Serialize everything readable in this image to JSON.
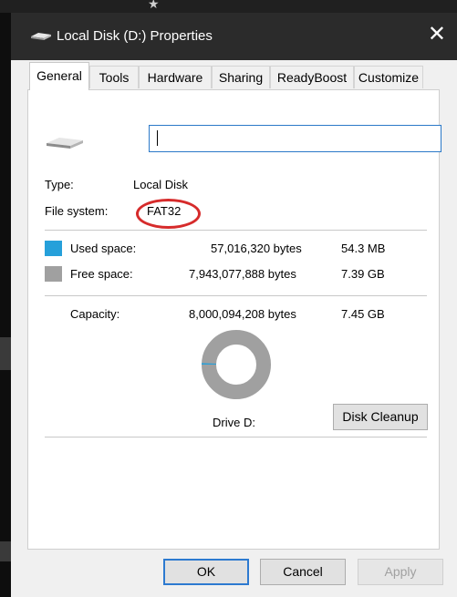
{
  "window": {
    "title": "Local Disk (D:) Properties",
    "close_glyph": "✕"
  },
  "tabs": [
    {
      "label": "General",
      "active": true
    },
    {
      "label": "Tools"
    },
    {
      "label": "Hardware"
    },
    {
      "label": "Sharing"
    },
    {
      "label": "ReadyBoost"
    },
    {
      "label": "Customize"
    }
  ],
  "general": {
    "name_value": "",
    "type_label": "Type:",
    "type_value": "Local Disk",
    "fs_label": "File system:",
    "fs_value": "FAT32",
    "used": {
      "label": "Used space:",
      "bytes": "57,016,320 bytes",
      "size": "54.3 MB",
      "color": "#26a0da"
    },
    "free": {
      "label": "Free space:",
      "bytes": "7,943,077,888 bytes",
      "size": "7.39 GB",
      "color": "#a0a0a0"
    },
    "capacity": {
      "label": "Capacity:",
      "bytes": "8,000,094,208 bytes",
      "size": "7.45 GB"
    },
    "usage_fraction": 0.0071,
    "drive_label": "Drive D:",
    "cleanup_label": "Disk Cleanup"
  },
  "buttons": {
    "ok": "OK",
    "cancel": "Cancel",
    "apply": "Apply"
  },
  "annotation": {
    "color": "#d62b2b"
  }
}
